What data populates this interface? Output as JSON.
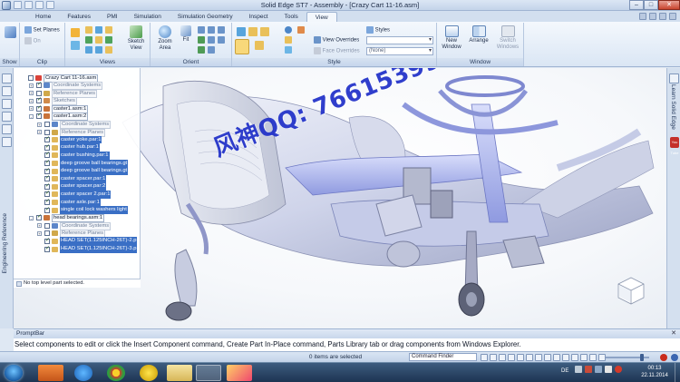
{
  "window": {
    "title": "Solid Edge ST7 - Assembly - [Crazy Cart 11-16.asm]",
    "controls": [
      "–",
      "□",
      "✕"
    ]
  },
  "tabs": [
    "Home",
    "Features",
    "PMI",
    "Simulation",
    "Simulation Geometry",
    "Inspect",
    "Tools",
    "View"
  ],
  "active_tab": "View",
  "ribbon": {
    "groups": {
      "show": "Show",
      "clip": "Clip",
      "views": "Views",
      "orient": "Orient",
      "style": "Style",
      "window": "Window"
    },
    "set_planes": "Set Planes",
    "on": "On",
    "sketch_view": "Sketch View",
    "zoom_area": "Zoom Area",
    "fit": "Fit",
    "view_overrides": "View Overrides",
    "face_overrides": "Face Overrides",
    "styles": "Styles",
    "styles_value": "",
    "face_overrides_value": "(None)",
    "new_window": "New Window",
    "arrange": "Arrange",
    "switch_windows": "Switch Windows"
  },
  "sidebar_left": {
    "engineering_reference": "Engineering Reference"
  },
  "sidebar_right": {
    "learn_solid_edge": "Learn Solid Edge",
    "youtube": "You Tube"
  },
  "pathfinder": {
    "nodes": [
      {
        "label": "Crazy Cart 11-16.asm",
        "level": 0,
        "exp": "",
        "check": false,
        "icon": "#d9423a",
        "style": "boxed"
      },
      {
        "label": "Coordinate Systems",
        "level": 1,
        "exp": "+",
        "check": true,
        "icon": "#5c86c9",
        "style": "ref"
      },
      {
        "label": "Reference Planes",
        "level": 1,
        "exp": "+",
        "check": false,
        "icon": "#d0a84a",
        "style": "ref"
      },
      {
        "label": "Sketches",
        "level": 1,
        "exp": "+",
        "check": true,
        "icon": "#d08a4a",
        "style": "ref"
      },
      {
        "label": "caster1.asm:1",
        "level": 1,
        "exp": "+",
        "check": true,
        "icon": "#c9733a",
        "style": "boxed"
      },
      {
        "label": "caster1.asm:2",
        "level": 1,
        "exp": "-",
        "check": true,
        "icon": "#c9733a",
        "style": "boxed"
      },
      {
        "label": "Coordinate Systems",
        "level": 2,
        "exp": "+",
        "check": false,
        "icon": "#5c86c9",
        "style": "ref"
      },
      {
        "label": "Reference Planes",
        "level": 2,
        "exp": "+",
        "check": false,
        "icon": "#d0a84a",
        "style": "ref"
      },
      {
        "label": "caster yoke.par:1",
        "level": 2,
        "exp": "",
        "check": true,
        "icon": "#e0b75a",
        "style": "hl"
      },
      {
        "label": "caster hub.par:1",
        "level": 2,
        "exp": "",
        "check": true,
        "icon": "#e0b75a",
        "style": "hl"
      },
      {
        "label": "caster bushing.par:1",
        "level": 2,
        "exp": "",
        "check": true,
        "icon": "#e0b75a",
        "style": "hl"
      },
      {
        "label": "deep groove ball bearings.gt",
        "level": 2,
        "exp": "",
        "check": true,
        "icon": "#e0b75a",
        "style": "hl"
      },
      {
        "label": "deep groove ball bearings.gt",
        "level": 2,
        "exp": "",
        "check": true,
        "icon": "#e0b75a",
        "style": "hl"
      },
      {
        "label": "caster spacer.par:1",
        "level": 2,
        "exp": "",
        "check": true,
        "icon": "#e0b75a",
        "style": "hl"
      },
      {
        "label": "caster spacer.par:2",
        "level": 2,
        "exp": "",
        "check": true,
        "icon": "#e0b75a",
        "style": "hl"
      },
      {
        "label": "caster spacer 2.par:1",
        "level": 2,
        "exp": "",
        "check": true,
        "icon": "#e0b75a",
        "style": "hl"
      },
      {
        "label": "caster axle.par:1",
        "level": 2,
        "exp": "",
        "check": true,
        "icon": "#e0b75a",
        "style": "hl"
      },
      {
        "label": "single coil lock washers light",
        "level": 2,
        "exp": "",
        "check": true,
        "icon": "#e0b75a",
        "style": "hl"
      },
      {
        "label": "head bearings.asm:1",
        "level": 1,
        "exp": "-",
        "check": true,
        "icon": "#c9733a",
        "style": "boxed"
      },
      {
        "label": "Coordinate Systems",
        "level": 2,
        "exp": "+",
        "check": false,
        "icon": "#5c86c9",
        "style": "ref"
      },
      {
        "label": "Reference Planes",
        "level": 2,
        "exp": "+",
        "check": false,
        "icon": "#d0a84a",
        "style": "ref"
      },
      {
        "label": "HEAD SET(1.125INCH-26T)-2.p",
        "level": 2,
        "exp": "",
        "check": true,
        "icon": "#e0b75a",
        "style": "hl"
      },
      {
        "label": "HEAD SET(1.125INCH-26T)-3.p",
        "level": 2,
        "exp": "",
        "check": true,
        "icon": "#e0b75a",
        "style": "hl"
      }
    ],
    "status": "No top level part selected."
  },
  "watermark": "风神QQ: 76615399",
  "promptbar": {
    "title": "PromptBar",
    "close": "✕",
    "text": "Select components to edit or click the Insert Component command, Create Part In-Place command, Parts Library tab or drag components from Windows Explorer."
  },
  "statusbar": {
    "selected": "0 items are selected",
    "command_finder": "Command Finder"
  },
  "taskbar": {
    "language": "DE",
    "time": "00:13",
    "date": "22.11.2014"
  },
  "colors": {
    "model_base": "#cfd4ea",
    "model_highlight": "#aab4f0",
    "watermark": "#1f2fc8"
  }
}
